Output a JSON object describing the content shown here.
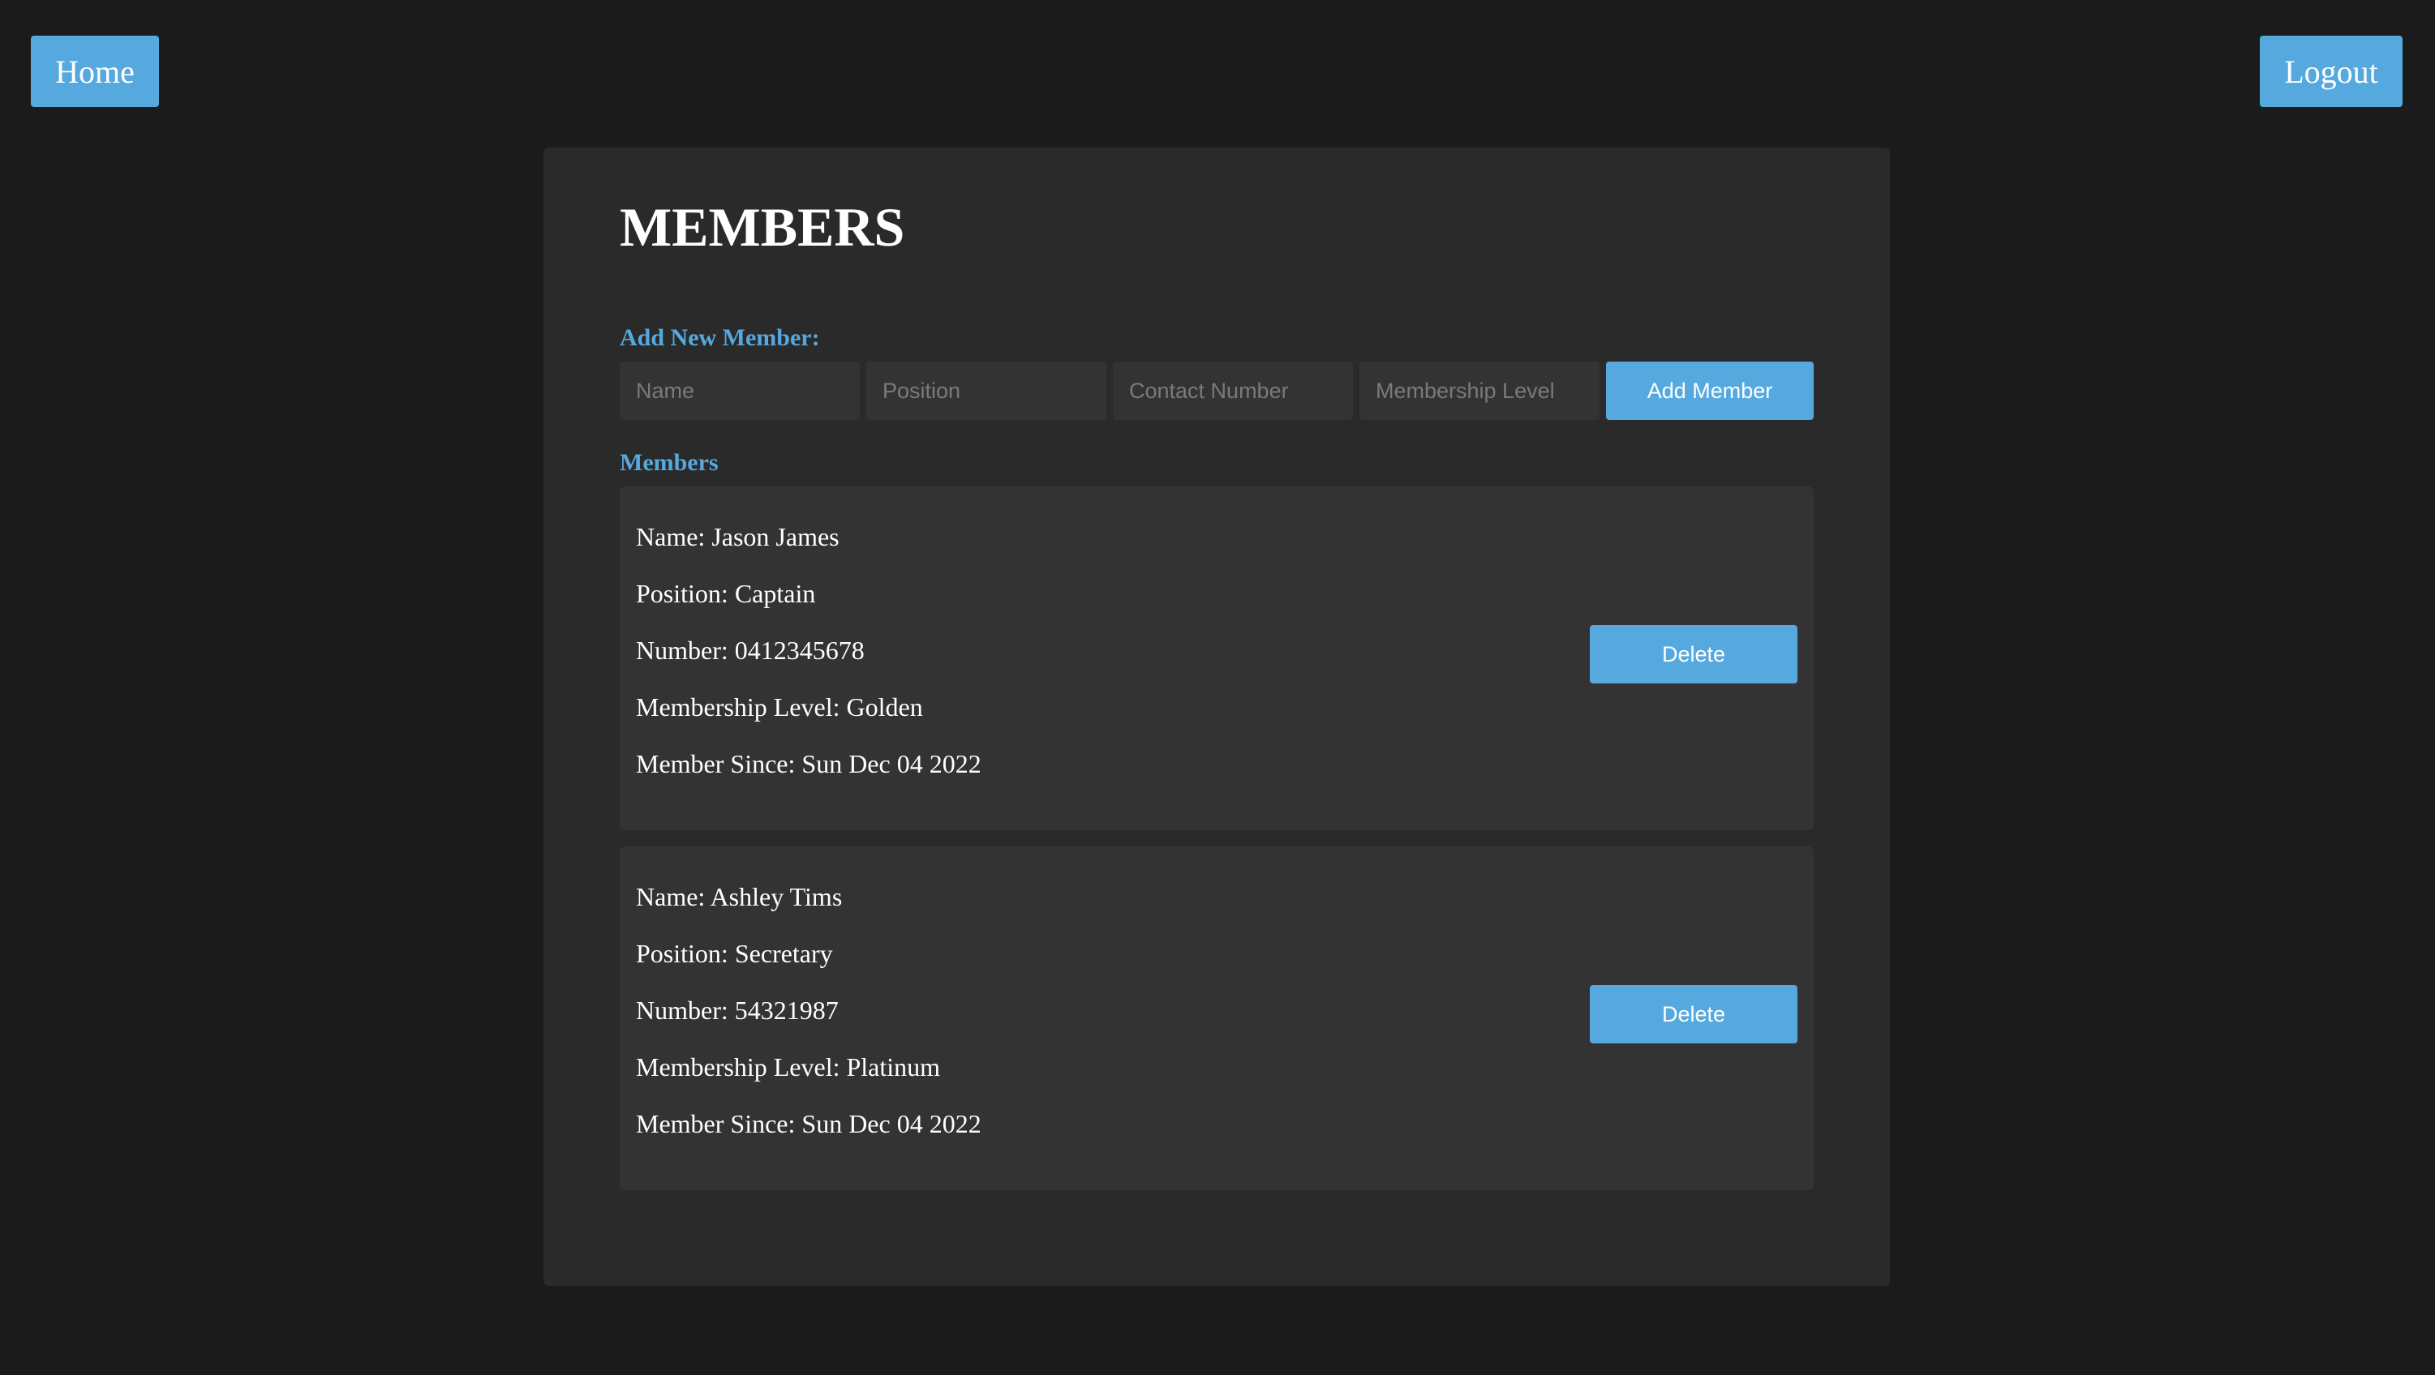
{
  "nav": {
    "home_label": "Home",
    "logout_label": "Logout"
  },
  "main": {
    "title": "MEMBERS",
    "add_section_label": "Add New Member:",
    "members_section_label": "Members"
  },
  "form": {
    "name_placeholder": "Name",
    "position_placeholder": "Position",
    "contact_placeholder": "Contact Number",
    "membership_placeholder": "Membership Level",
    "add_button_label": "Add Member"
  },
  "members": [
    {
      "name": "Name: Jason James",
      "position": "Position: Captain",
      "number": "Number: 0412345678",
      "level": "Membership Level: Golden",
      "since": "Member Since: Sun Dec 04 2022",
      "delete_label": "Delete"
    },
    {
      "name": "Name: Ashley Tims",
      "position": "Position: Secretary",
      "number": "Number: 54321987",
      "level": "Membership Level: Platinum",
      "since": "Member Since: Sun Dec 04 2022",
      "delete_label": "Delete"
    }
  ],
  "colors": {
    "background": "#1b1b1b",
    "panel": "#2a2a2a",
    "card": "#333333",
    "accent": "#56a9de",
    "text": "#ffffff"
  }
}
